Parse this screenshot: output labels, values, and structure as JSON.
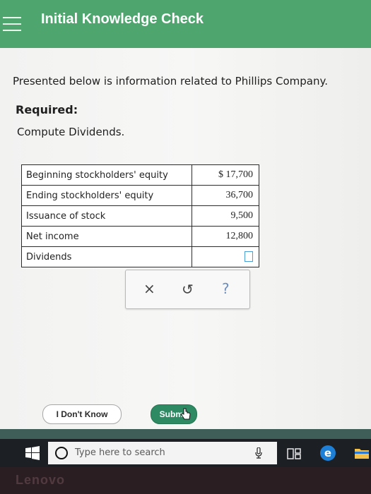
{
  "header": {
    "title": "Initial Knowledge Check",
    "menu_icon": "hamburger-menu-icon",
    "color": "#4ea56e"
  },
  "question": {
    "intro": "Presented below is information related to Phillips Company.",
    "required_label": "Required:",
    "instruction": "Compute Dividends."
  },
  "table": {
    "rows": [
      {
        "label": "Beginning stockholders' equity",
        "value": "$ 17,700"
      },
      {
        "label": "Ending stockholders' equity",
        "value": "36,700"
      },
      {
        "label": "Issuance of stock",
        "value": "9,500"
      },
      {
        "label": "Net income",
        "value": "12,800"
      },
      {
        "label": "Dividends",
        "value": ""
      }
    ]
  },
  "toolbar": {
    "clear_label": "×",
    "undo_label": "↺",
    "help_label": "?"
  },
  "footer": {
    "dont_know_label": "I Don't Know",
    "submit_label": "Submit",
    "submit_color": "#2d8a63"
  },
  "taskbar": {
    "search_placeholder": "Type here to search"
  },
  "bezel": {
    "brand": "Lenovo"
  }
}
